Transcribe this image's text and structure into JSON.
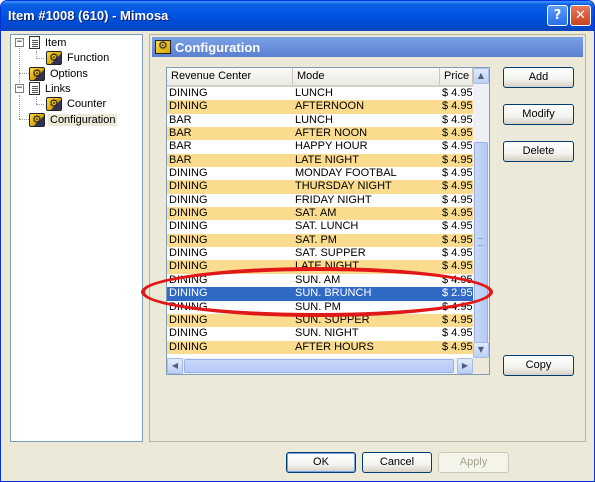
{
  "window": {
    "title": "Item #1008 (610) - Mimosa",
    "help_icon": "?",
    "close_icon": "✕"
  },
  "tree": {
    "items": [
      {
        "label": "Item",
        "icon": "page-icon"
      },
      {
        "label": "Function",
        "icon": "gear-icon"
      },
      {
        "label": "Options",
        "icon": "gear-icon"
      },
      {
        "label": "Links",
        "icon": "page-icon"
      },
      {
        "label": "Counter",
        "icon": "gear-icon"
      },
      {
        "label": "Configuration",
        "icon": "gear-icon"
      }
    ],
    "expander_minus": "−"
  },
  "config": {
    "title": "Configuration"
  },
  "list": {
    "columns": [
      "Revenue Center",
      "Mode",
      "Price"
    ],
    "rows": [
      {
        "rc": "DINING",
        "mode": "LUNCH",
        "price": "$ 4.95"
      },
      {
        "rc": "DINING",
        "mode": "AFTERNOON",
        "price": "$ 4.95"
      },
      {
        "rc": "BAR",
        "mode": "LUNCH",
        "price": "$ 4.95"
      },
      {
        "rc": "BAR",
        "mode": "AFTER NOON",
        "price": "$ 4.95"
      },
      {
        "rc": "BAR",
        "mode": "HAPPY HOUR",
        "price": "$ 4.95"
      },
      {
        "rc": "BAR",
        "mode": "LATE NIGHT",
        "price": "$ 4.95"
      },
      {
        "rc": "DINING",
        "mode": "MONDAY FOOTBAL",
        "price": "$ 4.95"
      },
      {
        "rc": "DINING",
        "mode": "THURSDAY NIGHT",
        "price": "$ 4.95"
      },
      {
        "rc": "DINING",
        "mode": "FRIDAY NIGHT",
        "price": "$ 4.95"
      },
      {
        "rc": "DINING",
        "mode": "SAT. AM",
        "price": "$ 4.95"
      },
      {
        "rc": "DINING",
        "mode": "SAT. LUNCH",
        "price": "$ 4.95"
      },
      {
        "rc": "DINING",
        "mode": "SAT. PM",
        "price": "$ 4.95"
      },
      {
        "rc": "DINING",
        "mode": "SAT. SUPPER",
        "price": "$ 4.95"
      },
      {
        "rc": "DINING",
        "mode": "LATE NIGHT",
        "price": "$ 4.95"
      },
      {
        "rc": "DINING",
        "mode": "SUN. AM",
        "price": "$ 4.95"
      },
      {
        "rc": "DINING",
        "mode": "SUN. BRUNCH",
        "price": "$ 2.95"
      },
      {
        "rc": "DINING",
        "mode": "SUN. PM",
        "price": "$ 4.95"
      },
      {
        "rc": "DINING",
        "mode": "SUN. SUPPER",
        "price": "$ 4.95"
      },
      {
        "rc": "DINING",
        "mode": "SUN. NIGHT",
        "price": "$ 4.95"
      },
      {
        "rc": "DINING",
        "mode": "AFTER HOURS",
        "price": "$ 4.95"
      }
    ],
    "selected_index": 15,
    "scroll_up": "▲",
    "scroll_down": "▼",
    "scroll_left": "◀",
    "scroll_right": "▶"
  },
  "buttons": {
    "add": "Add",
    "modify": "Modify",
    "delete": "Delete",
    "copy": "Copy",
    "ok": "OK",
    "cancel": "Cancel",
    "apply": "Apply"
  },
  "colors": {
    "title_bar": "#0054e3",
    "row_highlight": "#fbdc8f",
    "selection": "#316ac5",
    "annotation": "#e01818"
  }
}
